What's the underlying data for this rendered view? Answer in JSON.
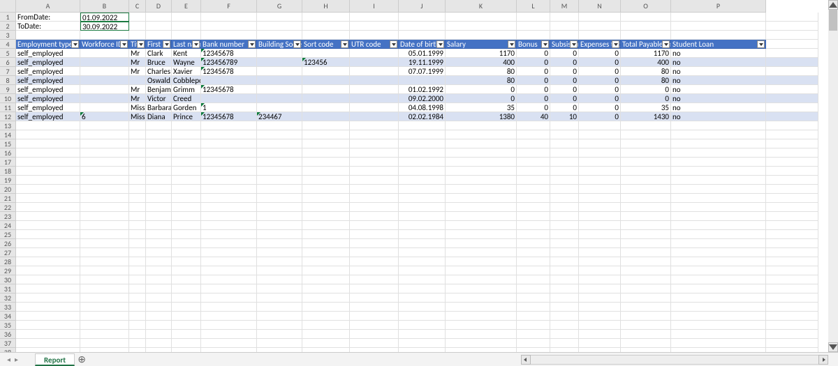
{
  "columns": [
    "A",
    "B",
    "C",
    "D",
    "E",
    "F",
    "G",
    "H",
    "I",
    "J",
    "K",
    "L",
    "M",
    "N",
    "O",
    "P"
  ],
  "col_widths": [
    "col-A",
    "col-B",
    "col-C",
    "col-D",
    "col-E",
    "col-F",
    "col-G",
    "col-H",
    "col-I",
    "col-J",
    "col-K",
    "col-L",
    "col-M",
    "col-N",
    "col-O",
    "col-P",
    "col-Q"
  ],
  "labels": {
    "from_date": "FromDate:",
    "to_date": "ToDate:"
  },
  "values": {
    "from_date": "01.09.2022",
    "to_date": "30.09.2022"
  },
  "table": {
    "headers": [
      "Employment type",
      "Workforce ID",
      "Title",
      "First name",
      "Last name",
      "Bank number",
      "Building Society",
      "Sort code",
      "UTR code",
      "Date of birth",
      "Salary",
      "Bonus",
      "Subsistence",
      "Expenses total",
      "Total Payable (inc. expenses)",
      "Student Loan"
    ],
    "header_display": [
      "Employment type",
      "Workforce ID",
      "Title",
      "First na",
      "Last name",
      "Bank number",
      "Building Socie",
      "Sort code",
      "UTR code",
      "Date of birth",
      "Salary",
      "Bonus",
      "Subsistence",
      "Expenses total",
      "Total Payable (inc. expenses)",
      "Student Loan"
    ],
    "numeric_cols": [
      10,
      11,
      12,
      13,
      14
    ],
    "rows": [
      {
        "cells": [
          "self_employed",
          "",
          "Mr",
          "Clark",
          "Kent",
          "12345678",
          "",
          "",
          "",
          "05.01.1999",
          "1170",
          "0",
          "0",
          "0",
          "1170",
          "no"
        ],
        "tri": [
          5
        ]
      },
      {
        "cells": [
          "self_employed",
          "",
          "Mr",
          "Bruce",
          "Wayne",
          "123456789",
          "",
          "123456",
          "",
          "19.11.1999",
          "400",
          "0",
          "0",
          "0",
          "400",
          "no"
        ],
        "tri": [
          5,
          7
        ]
      },
      {
        "cells": [
          "self_employed",
          "",
          "Mr",
          "Charles",
          "Xavier",
          "12345678",
          "",
          "",
          "",
          "07.07.1999",
          "80",
          "0",
          "0",
          "0",
          "80",
          "no"
        ],
        "tri": [
          5
        ]
      },
      {
        "cells": [
          "self_employed",
          "",
          "",
          "Oswald",
          "Cobblepot",
          "",
          "",
          "",
          "",
          "",
          "80",
          "0",
          "0",
          "0",
          "80",
          "no"
        ],
        "tri": []
      },
      {
        "cells": [
          "self_employed",
          "",
          "Mr",
          "Benjamin",
          "Grimm",
          "12345678",
          "",
          "",
          "",
          "01.02.1992",
          "0",
          "0",
          "0",
          "0",
          "0",
          "no"
        ],
        "tri": [
          5
        ]
      },
      {
        "cells": [
          "self_employed",
          "",
          "Mr",
          "Victor",
          "Creed",
          "",
          "",
          "",
          "",
          "09.02.2000",
          "0",
          "0",
          "0",
          "0",
          "0",
          "no"
        ],
        "tri": []
      },
      {
        "cells": [
          "self_employed",
          "",
          "Miss",
          "Barbara",
          "Gorden",
          "1",
          "",
          "",
          "",
          "04.08.1998",
          "35",
          "0",
          "0",
          "0",
          "35",
          "no"
        ],
        "tri": [
          5
        ]
      },
      {
        "cells": [
          "self_employed",
          "6",
          "Miss",
          "Diana",
          "Prince",
          "12345678",
          "234467",
          "",
          "",
          "02.02.1984",
          "1380",
          "40",
          "10",
          "0",
          "1430",
          "no"
        ],
        "tri": [
          1,
          5,
          6
        ]
      }
    ]
  },
  "tabs": {
    "active": "Report"
  },
  "row_count": 39
}
